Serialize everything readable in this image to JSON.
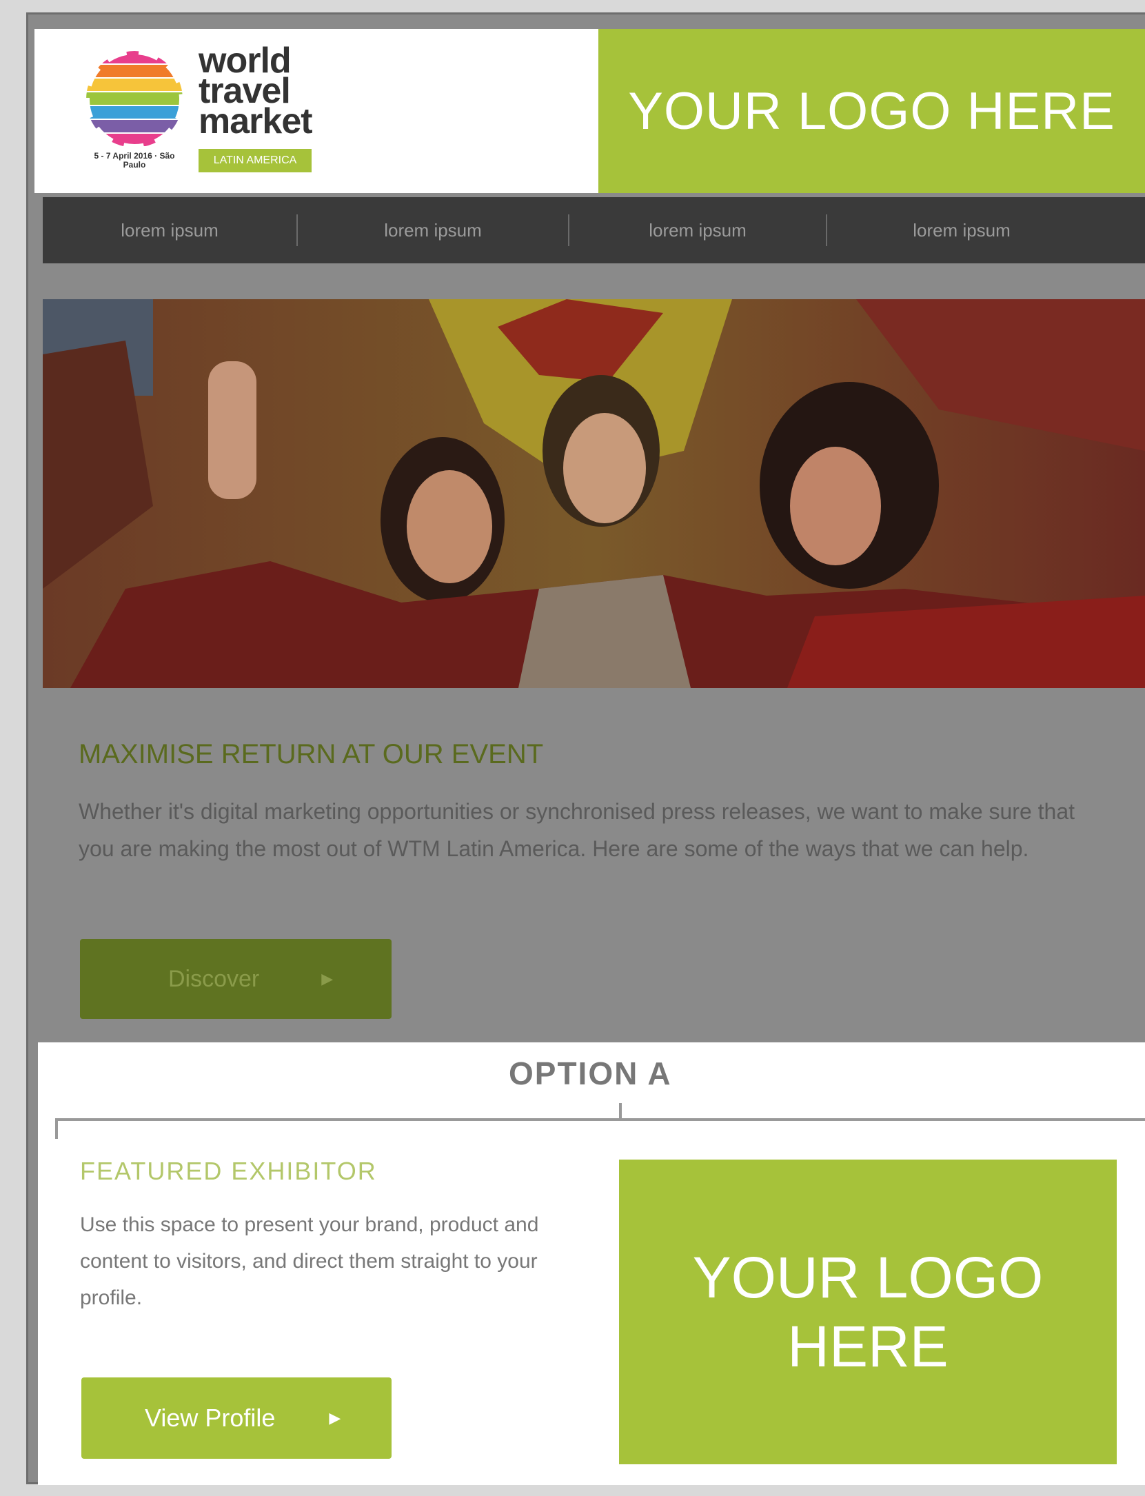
{
  "header": {
    "brand": {
      "wordmark": [
        "world",
        "travel",
        "market"
      ],
      "badge": "LATIN AMERICA",
      "dates": "5 - 7 April 2016 · São Paulo"
    },
    "logo_placeholder": "YOUR LOGO HERE"
  },
  "nav": {
    "items": [
      {
        "label": "lorem ipsum"
      },
      {
        "label": "lorem ipsum"
      },
      {
        "label": "lorem ipsum"
      },
      {
        "label": "lorem ipsum"
      }
    ]
  },
  "main": {
    "headline": "MAXIMISE RETURN AT OUR EVENT",
    "paragraph": "Whether it's digital marketing opportunities or synchronised press releases, we want to make sure that you are making the most out of WTM Latin America. Here are some of the ways that we can help.",
    "discover_label": "Discover"
  },
  "option": {
    "title": "OPTION A",
    "featured_title": "FEATURED EXHIBITOR",
    "featured_text": "Use this space to present your brand, product and content to visitors, and direct them straight to your profile.",
    "view_profile_label": "View Profile",
    "logo_placeholder": "YOUR LOGO HERE"
  },
  "colors": {
    "accent": "#a6c23a",
    "nav_bg": "#3a3a3a",
    "overlay": "#8a8a8a"
  },
  "icons": [
    "wtm-globe-icon",
    "play-arrow-icon"
  ]
}
